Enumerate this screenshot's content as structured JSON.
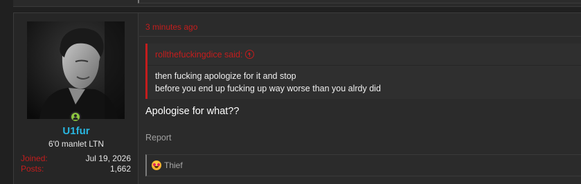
{
  "post": {
    "time_ago": "3 minutes ago",
    "quote": {
      "author_line": "rollthefuckingdice said:",
      "lines": [
        "then fucking apologize for it and stop",
        "before you end up fucking up way worse than you alrdy did"
      ]
    },
    "message": "Apologise for what??",
    "report_label": "Report",
    "reactions": {
      "text": "Thief",
      "icon": "heart-eyes-icon"
    }
  },
  "user": {
    "name": "U1fur",
    "title": "6'0 manlet LTN",
    "online_status": "online",
    "stats": [
      {
        "label": "Joined:",
        "value": "Jul 19, 2026"
      },
      {
        "label": "Posts:",
        "value": "1,662"
      }
    ]
  },
  "colors": {
    "accent_red": "#c41d1d",
    "username_blue": "#29b6e0",
    "online_green": "#8cc63f"
  }
}
